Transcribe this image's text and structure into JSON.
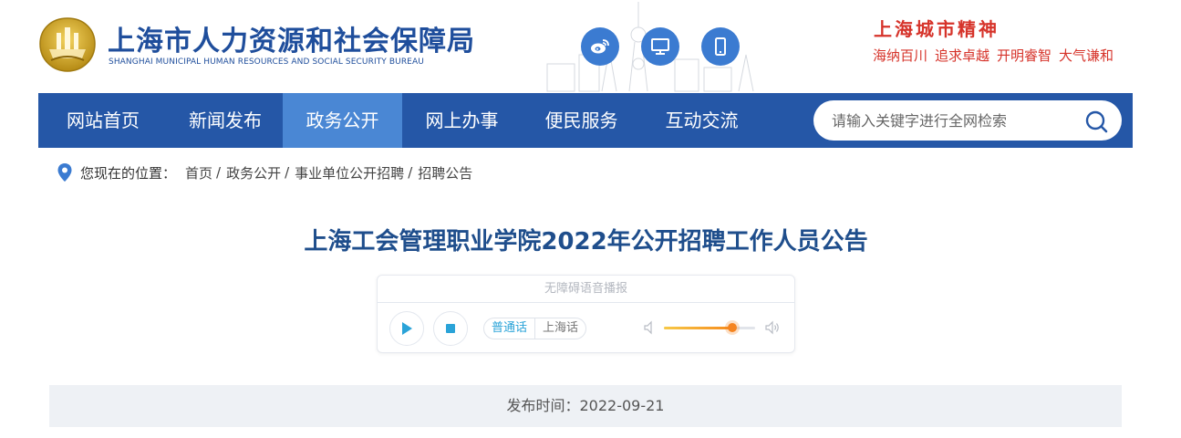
{
  "header": {
    "title": "上海市人力资源和社会保障局",
    "subtitle": "SHANGHAI MUNICIPAL HUMAN RESOURCES AND SOCIAL SECURITY BUREAU",
    "logo_icon": "bureau-emblem-icon",
    "share_buttons": [
      {
        "icon": "weibo-icon"
      },
      {
        "icon": "desktop-icon"
      },
      {
        "icon": "mobile-icon"
      }
    ],
    "spirit_title": "上海城市精神",
    "spirit_items": [
      "海纳百川",
      "追求卓越",
      "开明睿智",
      "大气谦和"
    ]
  },
  "nav": {
    "items": [
      "网站首页",
      "新闻发布",
      "政务公开",
      "网上办事",
      "便民服务",
      "互动交流"
    ],
    "active": "政务公开",
    "search_placeholder": "请输入关键字进行全网检索"
  },
  "breadcrumb": {
    "label": "您现在的位置：",
    "items": [
      "首页",
      "政务公开",
      "事业单位公开招聘",
      "招聘公告"
    ]
  },
  "article": {
    "title": "上海工会管理职业学院2022年公开招聘工作人员公告"
  },
  "player": {
    "header": "无障碍语音播报",
    "lang_options": [
      "普通话",
      "上海话"
    ],
    "active_lang": "普通话",
    "volume": 0.75
  },
  "publish": {
    "text": "发布时间：2022-09-21"
  },
  "colors": {
    "primary": "#2557a7",
    "nav_active": "#4a87d4",
    "title": "#1f4e8c",
    "spirit": "#d6332a",
    "accent": "#2aa3d8",
    "volume": "#f5841f"
  }
}
